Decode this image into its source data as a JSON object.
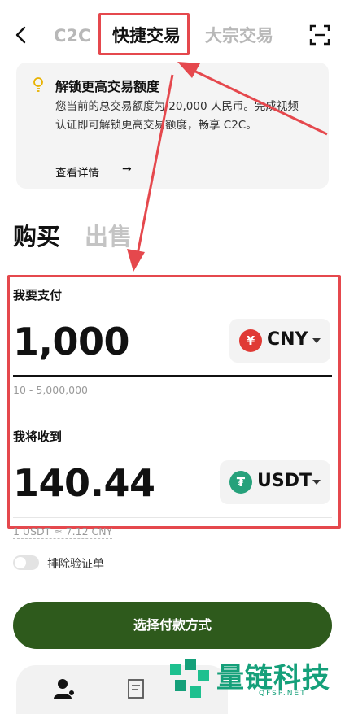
{
  "nav": {
    "tabs": [
      "C2C",
      "快捷交易",
      "大宗交易"
    ],
    "active_tab": 1
  },
  "notice": {
    "title": "解锁更高交易额度",
    "text": "您当前的总交易额度为 20,000 人民币。完成视频认证即可解锁更高交易额度，畅享 C2C。",
    "link": "查看详情",
    "link_arrow": "→",
    "icon": "lightbulb-icon"
  },
  "trade_tabs": {
    "buy": "购买",
    "sell": "出售",
    "active": "buy"
  },
  "pay": {
    "label": "我要支付",
    "amount": "1,000",
    "currency": "CNY",
    "currency_symbol": "¥",
    "range": "10 - 5,000,000"
  },
  "receive": {
    "label": "我将收到",
    "amount": "140.44",
    "currency": "USDT",
    "currency_symbol": "₮",
    "rate": "1 USDT ≈ 7.12 CNY"
  },
  "options": {
    "exclude_verified_label": "排除验证单",
    "exclude_verified_on": false
  },
  "cta": {
    "label": "选择付款方式"
  },
  "watermark": {
    "text": "量链科技",
    "sub": "QFSP.NET"
  },
  "colors": {
    "accent_green": "#2e5a1c",
    "annotation_red": "#e5484d",
    "cny_red": "#e03a35",
    "usdt_green": "#26a17b",
    "watermark_green": "#15a07a"
  }
}
